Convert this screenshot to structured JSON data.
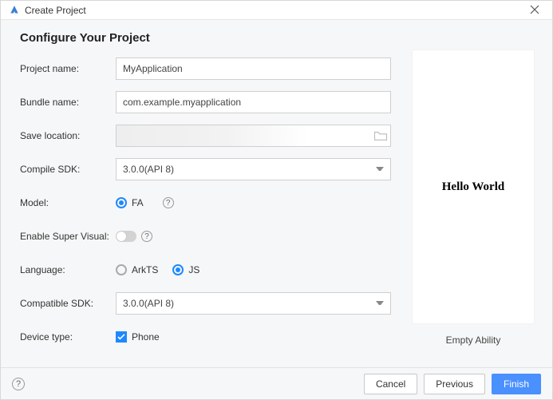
{
  "window": {
    "title": "Create Project"
  },
  "heading": "Configure Your Project",
  "labels": {
    "project_name": "Project name:",
    "bundle_name": "Bundle name:",
    "save_location": "Save location:",
    "compile_sdk": "Compile SDK:",
    "model": "Model:",
    "enable_super_visual": "Enable Super Visual:",
    "language": "Language:",
    "compatible_sdk": "Compatible SDK:",
    "device_type": "Device type:"
  },
  "values": {
    "project_name": "MyApplication",
    "bundle_name": "com.example.myapplication",
    "save_location": "",
    "compile_sdk": "3.0.0(API 8)",
    "compatible_sdk": "3.0.0(API 8)"
  },
  "model": {
    "options": [
      "FA"
    ],
    "selected": "FA"
  },
  "enable_super_visual": false,
  "language": {
    "option_arkts": "ArkTS",
    "option_js": "JS",
    "selected": "JS"
  },
  "device_type": {
    "option_phone": "Phone",
    "phone_checked": true
  },
  "preview": {
    "screen_text": "Hello World",
    "caption": "Empty Ability"
  },
  "buttons": {
    "cancel": "Cancel",
    "previous": "Previous",
    "finish": "Finish"
  },
  "colors": {
    "accent": "#1e88ff",
    "primary_btn": "#4a90ff"
  }
}
